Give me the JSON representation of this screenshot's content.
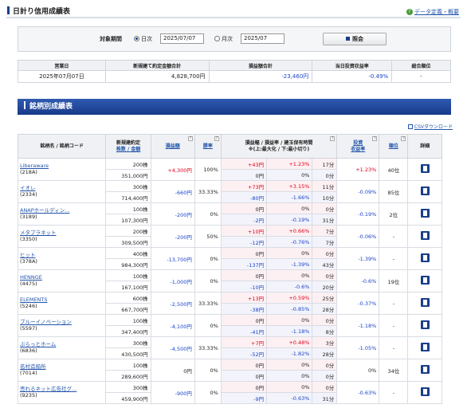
{
  "header": {
    "title": "日計り信用成績表",
    "help_label": "データ定義・概要",
    "help_icon": "question-icon"
  },
  "filter": {
    "period_label": "対象期間",
    "daily_label": "日次",
    "daily_selected": true,
    "daily_value": "2025/07/07",
    "monthly_label": "月次",
    "monthly_value": "2025/07",
    "submit_label": "照会"
  },
  "summary": {
    "headers": [
      "営業日",
      "新規建て約定金額合計",
      "損益額合計",
      "当日投資収益率",
      "総合順位"
    ],
    "row": [
      "2025年07月07日",
      "4,828,700円",
      "-23,460円",
      "-0.49%",
      "-"
    ]
  },
  "section_title": "銘柄別成績表",
  "csv_label": "CSVダウンロード",
  "table_headers": {
    "name": "銘柄名 / 銘柄コード",
    "amount_top": "新規建約定",
    "amount_bottom": "株数 / 金額",
    "pnl": "損益額",
    "win_rate": "勝率",
    "swing_top": "損益幅 / 損益率 / 建玉保有時間",
    "swing_bottom": "※(上:最大化 / 下:最小切り)",
    "roi_top": "投資",
    "roi_bottom": "収益率",
    "rank": "順位",
    "detail": "詳細"
  },
  "rows": [
    {
      "name": "Liberaware",
      "code": "(218A)",
      "shares": "200株",
      "amount": "351,000円",
      "pnl": "+4,300円",
      "pnl_c": "red",
      "win": "100%",
      "u_amt": "+43円",
      "u_amt_c": "red",
      "u_pct": "+1.23%",
      "u_pct_c": "red",
      "u_time": "17分",
      "l_amt": "0円",
      "l_amt_c": "",
      "l_pct": "0%",
      "l_pct_c": "",
      "l_time": "0分",
      "roi": "+1.23%",
      "roi_c": "red",
      "rank": "40位"
    },
    {
      "name": "イオレ",
      "code": "(2334)",
      "shares": "300株",
      "amount": "714,400円",
      "pnl": "-660円",
      "pnl_c": "blue",
      "win": "33.33%",
      "u_amt": "+73円",
      "u_amt_c": "red",
      "u_pct": "+3.15%",
      "u_pct_c": "red",
      "u_time": "11分",
      "l_amt": "-80円",
      "l_amt_c": "blue",
      "l_pct": "-1.66%",
      "l_pct_c": "blue",
      "l_time": "10分",
      "roi": "-0.09%",
      "roi_c": "blue",
      "rank": "85位"
    },
    {
      "name": "ANAPホールディン...",
      "code": "(3189)",
      "shares": "100株",
      "amount": "107,300円",
      "pnl": "-200円",
      "pnl_c": "blue",
      "win": "0%",
      "u_amt": "0円",
      "u_amt_c": "",
      "u_pct": "0%",
      "u_pct_c": "",
      "u_time": "0分",
      "l_amt": "-2円",
      "l_amt_c": "blue",
      "l_pct": "-0.19%",
      "l_pct_c": "blue",
      "l_time": "31分",
      "roi": "-0.19%",
      "roi_c": "blue",
      "rank": "2位"
    },
    {
      "name": "メタプラネット",
      "code": "(3350)",
      "shares": "200株",
      "amount": "309,500円",
      "pnl": "-200円",
      "pnl_c": "blue",
      "win": "50%",
      "u_amt": "+10円",
      "u_amt_c": "red",
      "u_pct": "+0.66%",
      "u_pct_c": "red",
      "u_time": "7分",
      "l_amt": "-12円",
      "l_amt_c": "blue",
      "l_pct": "-0.76%",
      "l_pct_c": "blue",
      "l_time": "7分",
      "roi": "-0.06%",
      "roi_c": "blue",
      "rank": "-"
    },
    {
      "name": "ヒット",
      "code": "(378A)",
      "shares": "400株",
      "amount": "984,300円",
      "pnl": "-13,700円",
      "pnl_c": "blue",
      "win": "0%",
      "u_amt": "0円",
      "u_amt_c": "",
      "u_pct": "0%",
      "u_pct_c": "",
      "u_time": "0分",
      "l_amt": "-137円",
      "l_amt_c": "blue",
      "l_pct": "-1.39%",
      "l_pct_c": "blue",
      "l_time": "43分",
      "roi": "-1.39%",
      "roi_c": "blue",
      "rank": "-"
    },
    {
      "name": "HENNGE",
      "code": "(4475)",
      "shares": "100株",
      "amount": "167,100円",
      "pnl": "-1,000円",
      "pnl_c": "blue",
      "win": "0%",
      "u_amt": "0円",
      "u_amt_c": "",
      "u_pct": "0%",
      "u_pct_c": "",
      "u_time": "0分",
      "l_amt": "-10円",
      "l_amt_c": "blue",
      "l_pct": "-0.6%",
      "l_pct_c": "blue",
      "l_time": "20分",
      "roi": "-0.6%",
      "roi_c": "blue",
      "rank": "19位"
    },
    {
      "name": "ELEMENTS",
      "code": "(5246)",
      "shares": "600株",
      "amount": "667,700円",
      "pnl": "-2,500円",
      "pnl_c": "blue",
      "win": "33.33%",
      "u_amt": "+13円",
      "u_amt_c": "red",
      "u_pct": "+0.59%",
      "u_pct_c": "red",
      "u_time": "25分",
      "l_amt": "-38円",
      "l_amt_c": "blue",
      "l_pct": "-0.85%",
      "l_pct_c": "blue",
      "l_time": "28分",
      "roi": "-0.37%",
      "roi_c": "blue",
      "rank": "-"
    },
    {
      "name": "ブルーイノベーション",
      "code": "(5597)",
      "shares": "100株",
      "amount": "347,400円",
      "pnl": "-4,100円",
      "pnl_c": "blue",
      "win": "0%",
      "u_amt": "0円",
      "u_amt_c": "",
      "u_pct": "0%",
      "u_pct_c": "",
      "u_time": "0分",
      "l_amt": "-41円",
      "l_amt_c": "blue",
      "l_pct": "-1.18%",
      "l_pct_c": "blue",
      "l_time": "8分",
      "roi": "-1.18%",
      "roi_c": "blue",
      "rank": "-"
    },
    {
      "name": "ぷらっとホーム",
      "code": "(6836)",
      "shares": "300株",
      "amount": "430,500円",
      "pnl": "-4,500円",
      "pnl_c": "blue",
      "win": "33.33%",
      "u_amt": "+7円",
      "u_amt_c": "red",
      "u_pct": "+0.48%",
      "u_pct_c": "red",
      "u_time": "3分",
      "l_amt": "-52円",
      "l_amt_c": "blue",
      "l_pct": "-1.82%",
      "l_pct_c": "blue",
      "l_time": "28分",
      "roi": "-1.05%",
      "roi_c": "blue",
      "rank": "-"
    },
    {
      "name": "名村造船所",
      "code": "(7014)",
      "shares": "100株",
      "amount": "289,600円",
      "pnl": "0円",
      "pnl_c": "",
      "win": "0%",
      "u_amt": "0円",
      "u_amt_c": "",
      "u_pct": "0%",
      "u_pct_c": "",
      "u_time": "0分",
      "l_amt": "0円",
      "l_amt_c": "",
      "l_pct": "0%",
      "l_pct_c": "",
      "l_time": "0分",
      "roi": "0%",
      "roi_c": "",
      "rank": "34位"
    },
    {
      "name": "売れるネット広告社グ...",
      "code": "(9235)",
      "shares": "300株",
      "amount": "459,900円",
      "pnl": "-900円",
      "pnl_c": "blue",
      "win": "0%",
      "u_amt": "0円",
      "u_amt_c": "",
      "u_pct": "0%",
      "u_pct_c": "",
      "u_time": "0分",
      "l_amt": "-9円",
      "l_amt_c": "blue",
      "l_pct": "-0.63%",
      "l_pct_c": "blue",
      "l_time": "31分",
      "roi": "-0.63%",
      "roi_c": "blue",
      "rank": "-"
    }
  ]
}
